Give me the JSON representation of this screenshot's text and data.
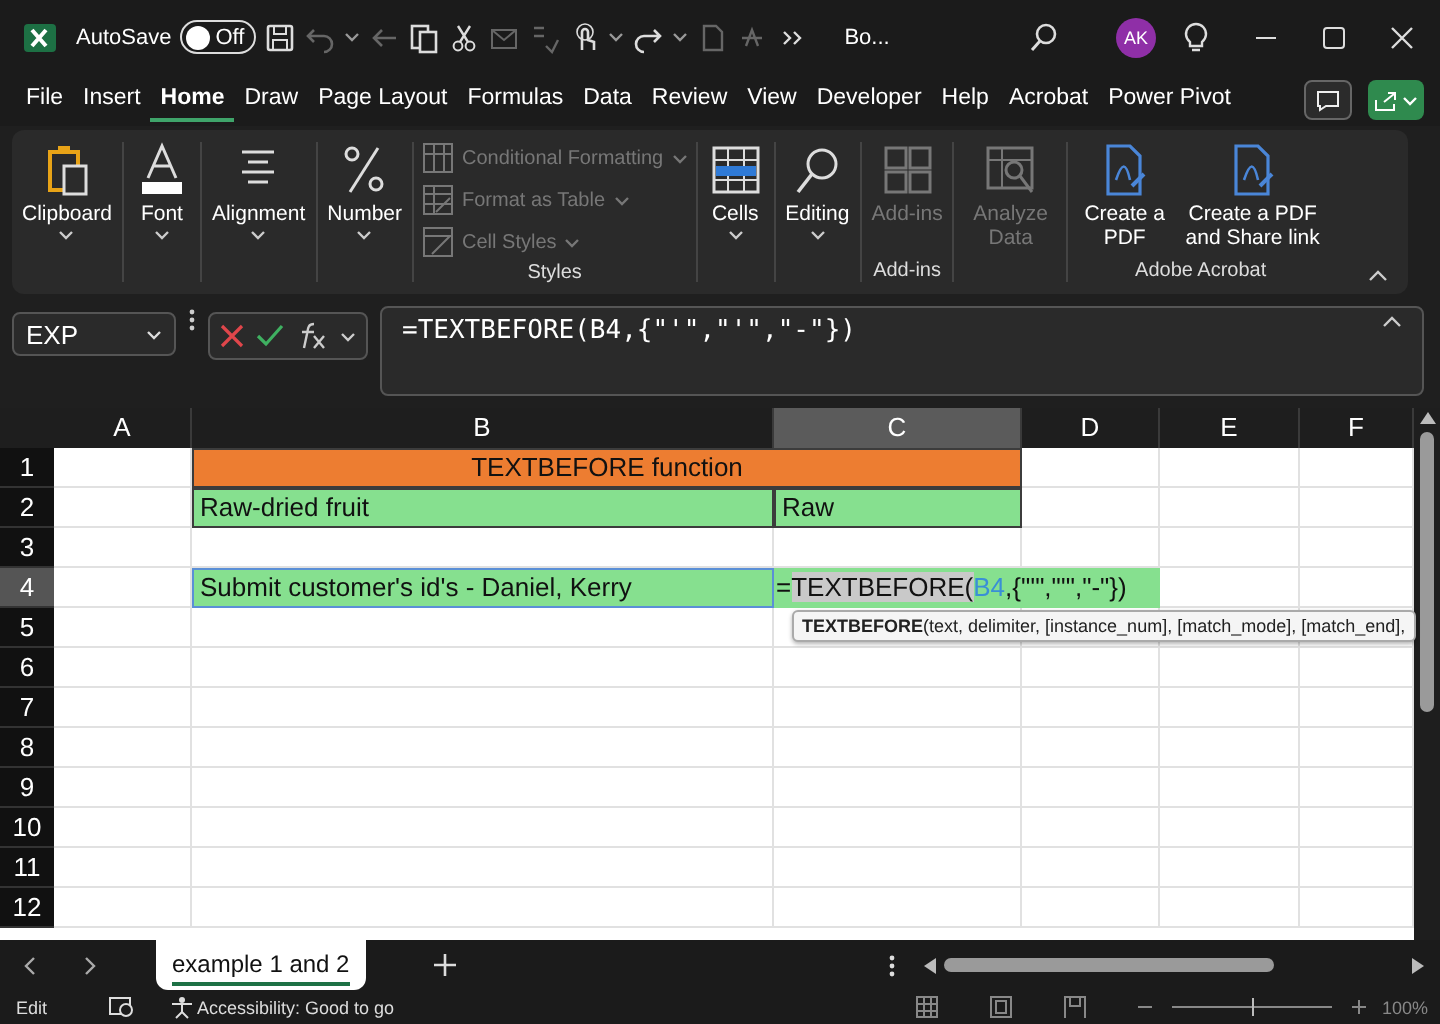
{
  "title_bar": {
    "autosave_label": "AutoSave",
    "autosave": {
      "label": "Off",
      "on": false
    },
    "document_title": "Bo...",
    "user_initials": "AK"
  },
  "menu_tabs": [
    {
      "label": "File",
      "selected": false
    },
    {
      "label": "Insert",
      "selected": false
    },
    {
      "label": "Home",
      "selected": true
    },
    {
      "label": "Draw",
      "selected": false
    },
    {
      "label": "Page Layout",
      "selected": false
    },
    {
      "label": "Formulas",
      "selected": false
    },
    {
      "label": "Data",
      "selected": false
    },
    {
      "label": "Review",
      "selected": false
    },
    {
      "label": "View",
      "selected": false
    },
    {
      "label": "Developer",
      "selected": false
    },
    {
      "label": "Help",
      "selected": false
    },
    {
      "label": "Acrobat",
      "selected": false
    },
    {
      "label": "Power Pivot",
      "selected": false
    }
  ],
  "ribbon": {
    "groups": [
      {
        "kind": "large",
        "buttons": [
          {
            "label": "Clipboard",
            "dropdown": true,
            "disabled": false
          }
        ]
      },
      {
        "kind": "large",
        "buttons": [
          {
            "label": "Font",
            "dropdown": true,
            "disabled": false
          }
        ]
      },
      {
        "kind": "large",
        "buttons": [
          {
            "label": "Alignment",
            "dropdown": true,
            "disabled": false
          }
        ]
      },
      {
        "kind": "large",
        "buttons": [
          {
            "label": "Number",
            "dropdown": true,
            "disabled": false
          }
        ]
      },
      {
        "kind": "stack",
        "label": "Styles",
        "buttons": [
          {
            "label": "Conditional Formatting",
            "dropdown": true,
            "disabled": true
          },
          {
            "label": "Format as Table",
            "dropdown": true,
            "disabled": true
          },
          {
            "label": "Cell Styles",
            "dropdown": true,
            "disabled": true
          }
        ]
      },
      {
        "kind": "large",
        "buttons": [
          {
            "label": "Cells",
            "dropdown": true,
            "disabled": false
          }
        ]
      },
      {
        "kind": "large",
        "buttons": [
          {
            "label": "Editing",
            "dropdown": true,
            "disabled": false
          }
        ]
      },
      {
        "kind": "large",
        "label": "Add-ins",
        "buttons": [
          {
            "label": "Add-ins",
            "dropdown": false,
            "disabled": true
          }
        ]
      },
      {
        "kind": "large",
        "buttons": [
          {
            "label": "Analyze Data",
            "dropdown": false,
            "disabled": true
          }
        ]
      },
      {
        "kind": "large",
        "label": "Adobe Acrobat",
        "buttons": [
          {
            "label": "Create a PDF",
            "dropdown": false,
            "disabled": false
          },
          {
            "label": "Create a PDF and Share link",
            "dropdown": false,
            "disabled": false
          }
        ]
      }
    ]
  },
  "formula_bar": {
    "name_box": "EXP",
    "formula": "=TEXTBEFORE(B4,{\"'\",\"'\",\"-\"})"
  },
  "sheet": {
    "columns": [
      {
        "label": "A",
        "selected": false
      },
      {
        "label": "B",
        "selected": false
      },
      {
        "label": "C",
        "selected": true
      },
      {
        "label": "D",
        "selected": false
      },
      {
        "label": "E",
        "selected": false
      },
      {
        "label": "F",
        "selected": false
      }
    ],
    "rows": [
      {
        "label": "1",
        "selected": false,
        "cells": [
          {
            "text": "TEXTBEFORE function",
            "color": "#ed7d31"
          }
        ]
      },
      {
        "label": "2",
        "selected": false,
        "cells": [
          {
            "text": "Raw-dried fruit",
            "color": "#86e08f"
          },
          {
            "text": "Raw",
            "color": "#86e08f"
          }
        ]
      },
      {
        "label": "3",
        "selected": false
      },
      {
        "label": "4",
        "selected": true,
        "cells": [
          {
            "text": "Submit customer's id's - Daniel, Kerry",
            "color": "#86e08f",
            "selected": true
          },
          {
            "color": "#86e08f",
            "editing": true,
            "parts": [
              {
                "kind": "plain",
                "text": "="
              },
              {
                "kind": "function",
                "text": "TEXTBEFORE("
              },
              {
                "kind": "reference",
                "text": "B4"
              },
              {
                "kind": "plain",
                "text": ",{\"'\",\"'\",\"-\"})"
              }
            ]
          }
        ]
      },
      {
        "label": "5",
        "selected": false
      },
      {
        "label": "6",
        "selected": false
      },
      {
        "label": "7",
        "selected": false
      },
      {
        "label": "8",
        "selected": false
      },
      {
        "label": "9",
        "selected": false
      },
      {
        "label": "10",
        "selected": false
      },
      {
        "label": "11",
        "selected": false
      },
      {
        "label": "12",
        "selected": false
      }
    ],
    "tooltip": "**TEXTBEFORE**(text, delimiter, [instance_num], [match_mode], [match_end],"
  },
  "sheet_tabs": [
    {
      "label": "example 1 and 2",
      "selected": true
    }
  ],
  "status_bar": {
    "mode": "Edit",
    "accessibility": "Accessibility: Good to go",
    "zoom": "100%",
    "zoom_slider": {
      "level": 0.5
    }
  }
}
